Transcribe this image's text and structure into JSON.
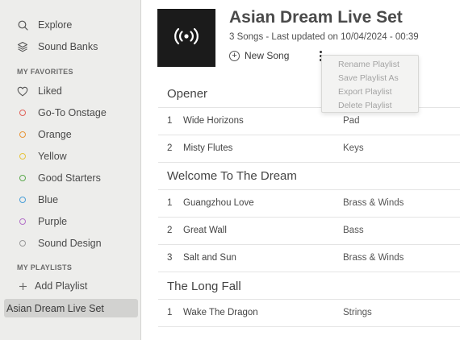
{
  "sidebar": {
    "nav": [
      {
        "label": "Explore",
        "icon": "search-icon"
      },
      {
        "label": "Sound Banks",
        "icon": "layers-icon"
      }
    ],
    "favorites_header": "MY FAVORITES",
    "favorites": [
      {
        "label": "Liked",
        "icon": "heart-icon",
        "color": ""
      },
      {
        "label": "Go-To Onstage",
        "icon": "dot-icon",
        "color": "#e0625a"
      },
      {
        "label": "Orange",
        "icon": "dot-icon",
        "color": "#e8973a"
      },
      {
        "label": "Yellow",
        "icon": "dot-icon",
        "color": "#e6c440"
      },
      {
        "label": "Good Starters",
        "icon": "dot-icon",
        "color": "#5daa4f"
      },
      {
        "label": "Blue",
        "icon": "dot-icon",
        "color": "#4a9fd8"
      },
      {
        "label": "Purple",
        "icon": "dot-icon",
        "color": "#b473c9"
      },
      {
        "label": "Sound Design",
        "icon": "dot-icon",
        "color": "#9a9a9a"
      }
    ],
    "playlists_header": "MY PLAYLISTS",
    "add_playlist": "Add Playlist",
    "playlists": [
      "Asian Dream Live Set"
    ]
  },
  "playlist": {
    "title": "Asian Dream Live Set",
    "meta": "3 Songs - Last updated on 10/04/2024 - 00:39",
    "new_song": "New Song",
    "artwork_icon": "broadcast-icon",
    "sections": [
      {
        "title": "Opener",
        "rows": [
          {
            "num": "1",
            "name": "Wide Horizons",
            "category": "Pad"
          },
          {
            "num": "2",
            "name": "Misty Flutes",
            "category": "Keys"
          }
        ]
      },
      {
        "title": "Welcome To The Dream",
        "rows": [
          {
            "num": "1",
            "name": "Guangzhou Love",
            "category": "Brass & Winds"
          },
          {
            "num": "2",
            "name": "Great Wall",
            "category": "Bass"
          },
          {
            "num": "3",
            "name": "Salt and Sun",
            "category": "Brass & Winds"
          }
        ]
      },
      {
        "title": "The Long Fall",
        "rows": [
          {
            "num": "1",
            "name": "Wake The Dragon",
            "category": "Strings"
          }
        ]
      }
    ]
  },
  "context_menu": {
    "items": [
      "Rename Playlist",
      "Save Playlist As",
      "Export Playlist",
      "Delete Playlist"
    ]
  },
  "colors": {
    "sidebar_bg": "#ededeb",
    "selected_bg": "#d2d2d0",
    "artwork_bg": "#1b1b1b"
  }
}
